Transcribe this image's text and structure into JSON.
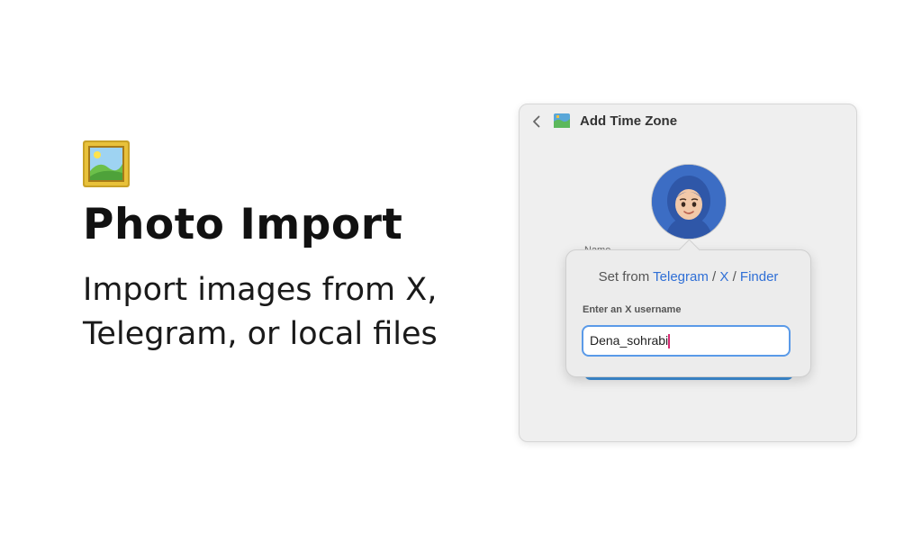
{
  "hero": {
    "icon": "framed-picture-icon",
    "title": "Photo Import",
    "subtitle": "Import images from X, Telegram, or local files"
  },
  "window": {
    "title": "Add Time Zone",
    "back_icon": "chevron-left-icon",
    "title_icon": "map-icon",
    "avatar_icon": "memoji-avatar",
    "name_label_partial": "Name"
  },
  "popover": {
    "set_from_label": "Set from",
    "sources": [
      "Telegram",
      "X",
      "Finder"
    ],
    "separator": "/",
    "input_label": "Enter an X username",
    "input_value": "Dena_sohrabi"
  },
  "colors": {
    "link": "#2f6fd6",
    "input_focus": "#5a9ae8",
    "caret": "#d62b72",
    "avatar_bg": "#3e6fc7"
  }
}
